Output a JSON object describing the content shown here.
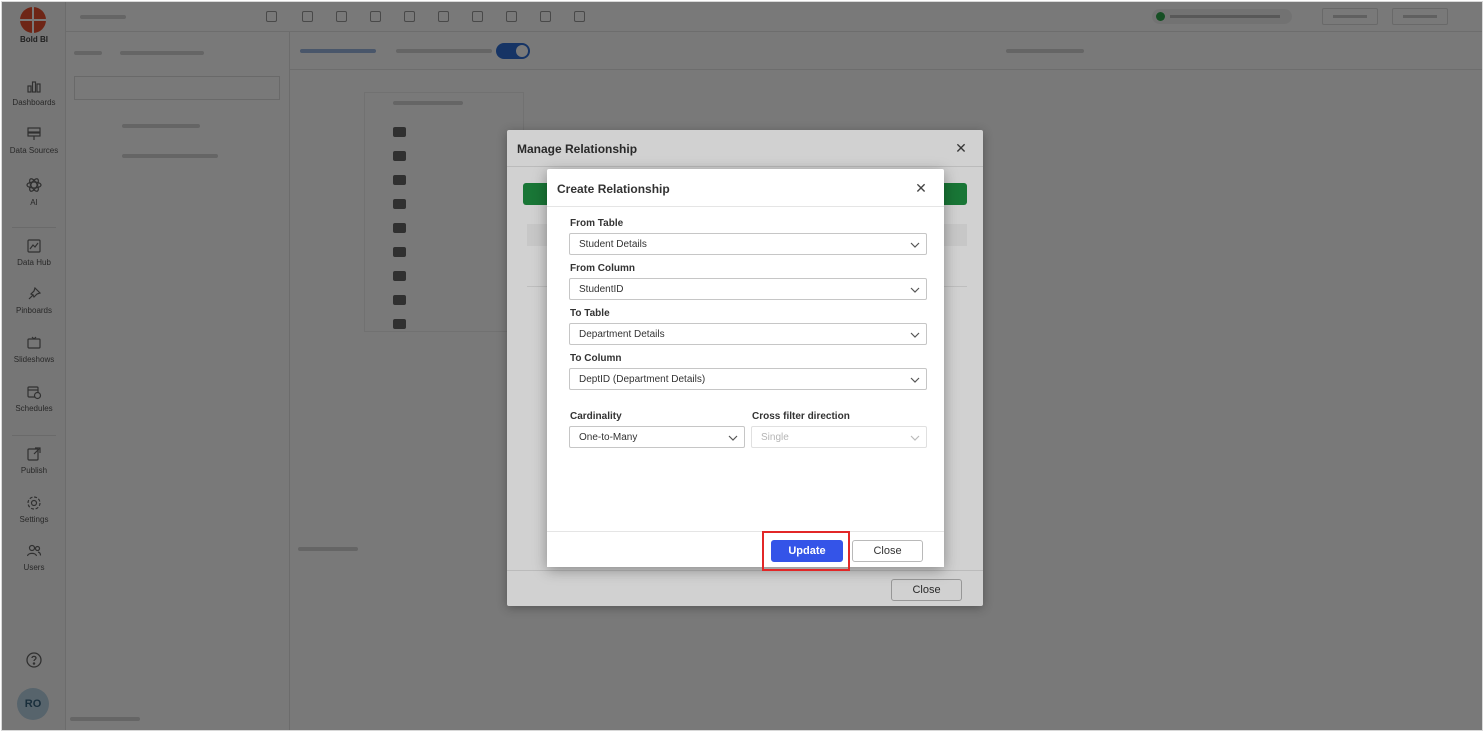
{
  "nav": {
    "brand": "Bold BI",
    "items": [
      {
        "label": "Dashboards"
      },
      {
        "label": "Data Sources"
      },
      {
        "label": "AI"
      },
      {
        "label": "Data Hub"
      },
      {
        "label": "Pinboards"
      },
      {
        "label": "Slideshows"
      },
      {
        "label": "Schedules"
      },
      {
        "label": "Publish"
      },
      {
        "label": "Settings"
      },
      {
        "label": "Users"
      }
    ],
    "avatar_initials": "RO"
  },
  "manage_dialog": {
    "title": "Manage Relationship",
    "close_label": "Close"
  },
  "create_dialog": {
    "title": "Create Relationship",
    "from_table": {
      "label": "From Table",
      "value": "Student Details"
    },
    "from_column": {
      "label": "From Column",
      "value": "StudentID"
    },
    "to_table": {
      "label": "To Table",
      "value": "Department Details"
    },
    "to_column": {
      "label": "To Column",
      "value": "DeptID (Department Details)"
    },
    "cardinality": {
      "label": "Cardinality",
      "value": "One-to-Many"
    },
    "cross_filter": {
      "label": "Cross filter direction",
      "value": "Single"
    },
    "update_label": "Update",
    "close_label": "Close"
  },
  "colors": {
    "primary": "#3454e8",
    "green_bar": "#1f9142",
    "highlight": "#e22727",
    "brand": "#e8502f"
  }
}
